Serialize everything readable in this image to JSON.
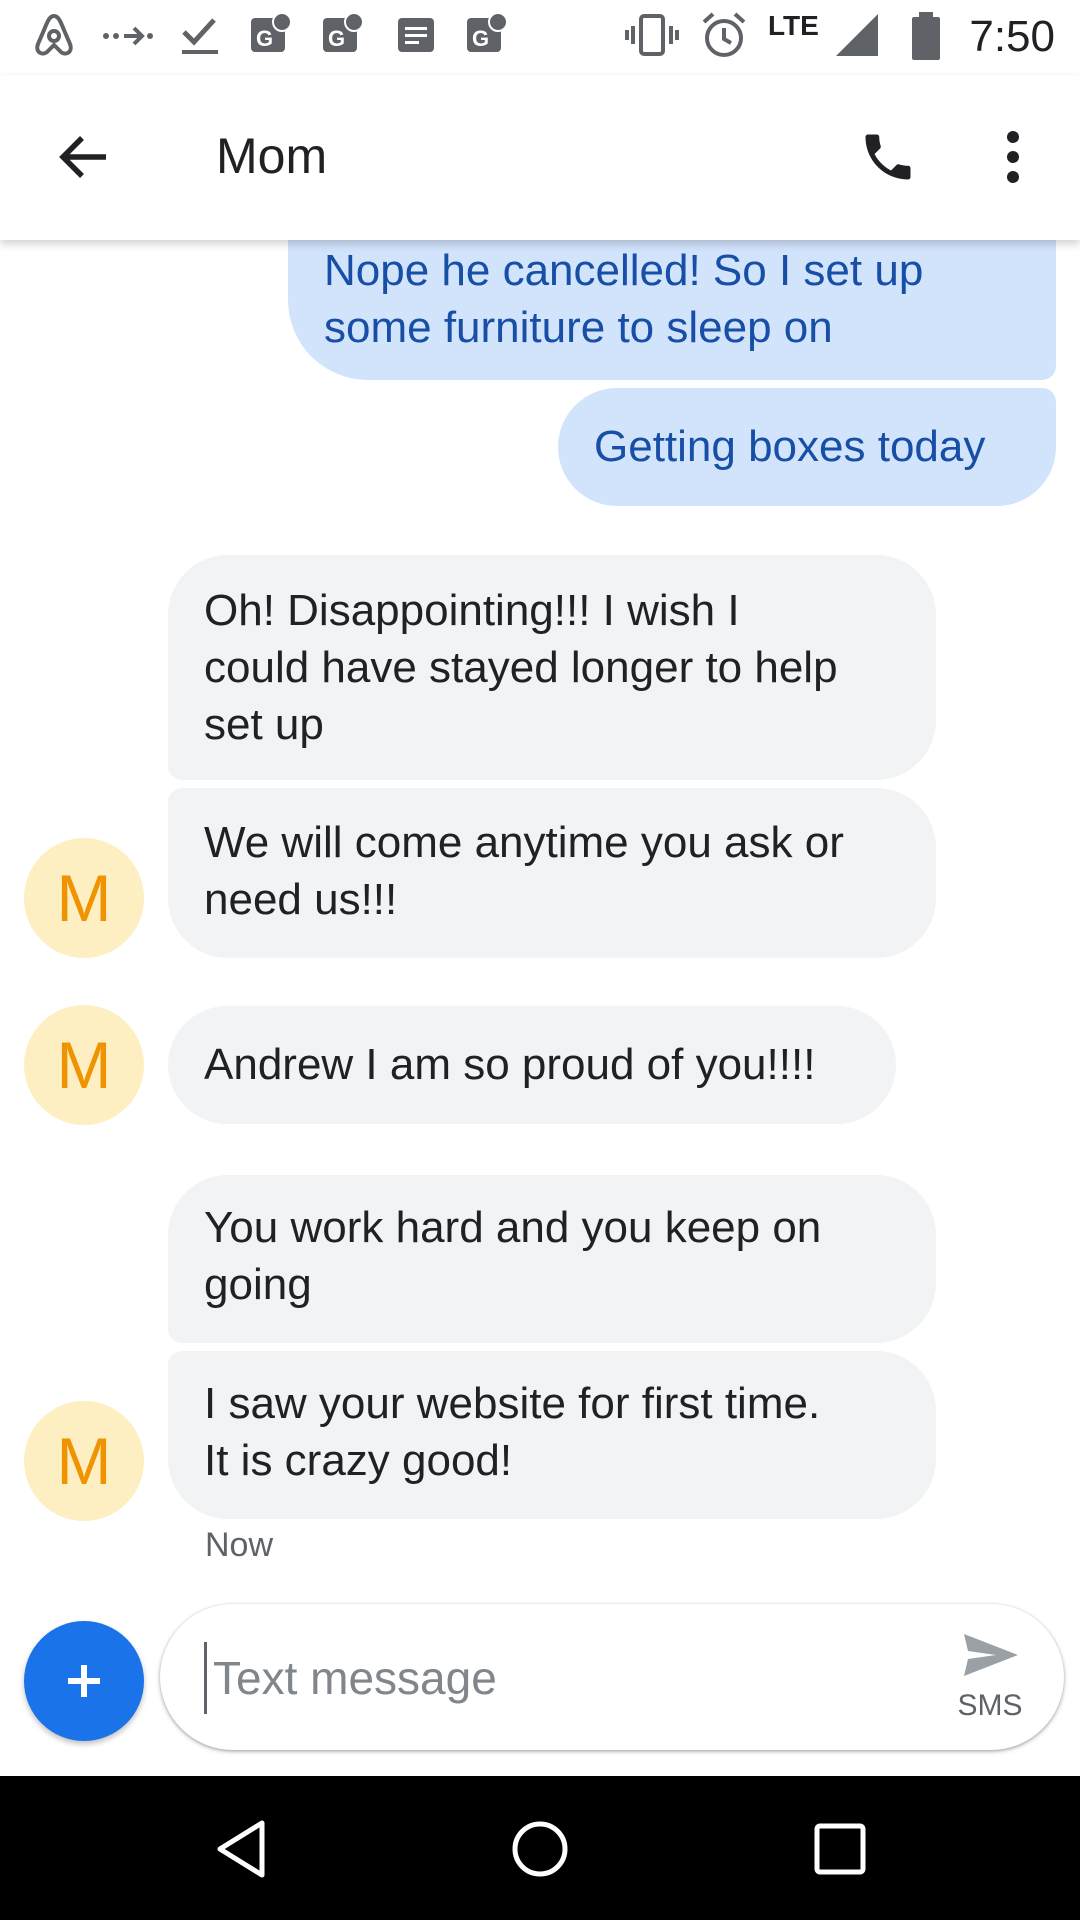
{
  "status_bar": {
    "time": "7:50",
    "network": "LTE",
    "left_icons": [
      "airbnb-icon",
      "forward-dots-icon",
      "check-icon",
      "google-maps-icon",
      "google-maps-icon",
      "messages-icon",
      "google-maps-icon"
    ],
    "right_icons": [
      "vibrate-icon",
      "alarm-icon",
      "signal-icon",
      "battery-icon"
    ]
  },
  "app_bar": {
    "title": "Mom",
    "back_icon": "arrow-back-icon",
    "call_icon": "phone-icon",
    "more_icon": "more-vert-icon"
  },
  "messages": [
    {
      "direction": "outgoing",
      "lines": [
        "Nope he cancelled!  So I set up",
        "some furniture to sleep on"
      ]
    },
    {
      "direction": "outgoing",
      "lines": [
        "Getting boxes today"
      ]
    },
    {
      "direction": "incoming",
      "lines": [
        "Oh!  Disappointing!!!  I wish I",
        "could have stayed longer to help",
        "set up"
      ]
    },
    {
      "direction": "incoming",
      "lines": [
        "We will come anytime you ask or",
        "need us!!!"
      ],
      "avatar": "M"
    },
    {
      "direction": "incoming",
      "lines": [
        "Andrew I am so proud of you!!!!"
      ],
      "avatar": "M"
    },
    {
      "direction": "incoming",
      "lines": [
        "You work hard and you keep on",
        "going"
      ]
    },
    {
      "direction": "incoming",
      "lines": [
        "I saw your website for first time.",
        "It is crazy good!"
      ],
      "avatar": "M"
    }
  ],
  "timestamp": "Now",
  "compose": {
    "placeholder": "Text message",
    "value": "",
    "send_label": "SMS",
    "add_icon": "plus-icon",
    "send_icon": "send-icon"
  },
  "nav_bar": {
    "buttons": [
      "back-triangle-icon",
      "home-circle-icon",
      "recents-square-icon"
    ]
  },
  "colors": {
    "outgoing_bubble": "#d2e3fc",
    "outgoing_text": "#174ea6",
    "incoming_bubble": "#f1f3f4",
    "avatar_bg": "#feefc3",
    "avatar_letter": "#f09300",
    "fab": "#1a73e8"
  }
}
